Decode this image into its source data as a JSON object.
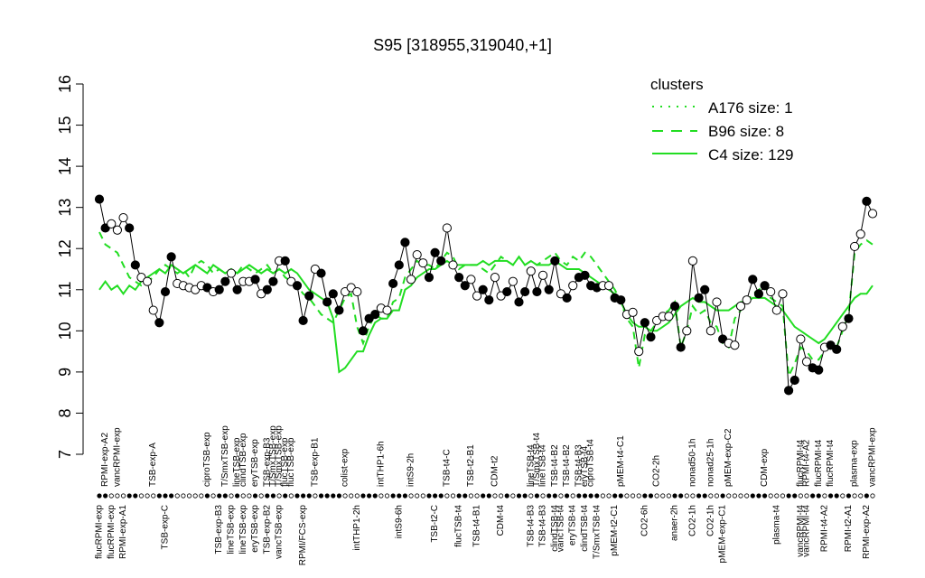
{
  "chart_data": {
    "type": "line",
    "title": "S95 [318955,319040,+1]",
    "xlabel": "",
    "ylabel": "",
    "ylim": [
      7,
      16
    ],
    "yticks": [
      7,
      8,
      9,
      10,
      11,
      12,
      13,
      14,
      15,
      16
    ],
    "grid": false,
    "legend": {
      "title": "clusters",
      "placement": "top-right",
      "color": "#22dd22",
      "items": [
        {
          "label": "A176 size: 1",
          "style": "dotted"
        },
        {
          "label": "B96 size: 8",
          "style": "dashed"
        },
        {
          "label": "C4 size: 129",
          "style": "solid"
        }
      ]
    },
    "top_labels": [
      {
        "i": 1,
        "t": "RPMI-exp-A2"
      },
      {
        "i": 3,
        "t": "vancRPMI-exp"
      },
      {
        "i": 9,
        "t": "TSB-exp-A"
      },
      {
        "i": 18,
        "t": "ciproTSB-exp"
      },
      {
        "i": 21,
        "t": "T/SmxTSB-exp"
      },
      {
        "i": 23,
        "t": "lineTSB-exp"
      },
      {
        "i": 24,
        "t": "clindTSB-exp"
      },
      {
        "i": 26,
        "t": "eryTSB-exp"
      },
      {
        "i": 28,
        "t": "TSB-exp-B3"
      },
      {
        "i": 29,
        "t": "T/SmxTSB-exp"
      },
      {
        "i": 30,
        "t": "T/SmxTSB-exp"
      },
      {
        "i": 31,
        "t": "flucTSB-exp"
      },
      {
        "i": 32,
        "t": "flucTSB-exp"
      },
      {
        "i": 36,
        "t": "TSB-exp-B1"
      },
      {
        "i": 41,
        "t": "colist-exp"
      },
      {
        "i": 47,
        "t": "intTHP1-6h"
      },
      {
        "i": 52,
        "t": "intS9-2h"
      },
      {
        "i": 58,
        "t": "TSB-t4-C"
      },
      {
        "i": 62,
        "t": "TSB-t2-B1"
      },
      {
        "i": 66,
        "t": "CDM-t2"
      },
      {
        "i": 72,
        "t": "lineTSB-t4"
      },
      {
        "i": 73,
        "t": "T/SmxTSB-t4"
      },
      {
        "i": 74,
        "t": "lineTSB-t4"
      },
      {
        "i": 76,
        "t": "TSB-t4-B2"
      },
      {
        "i": 78,
        "t": "TSB-t4-B2"
      },
      {
        "i": 80,
        "t": "TSB-t4-B3"
      },
      {
        "i": 81,
        "t": "eryTSB-t4"
      },
      {
        "i": 82,
        "t": "ciproTSB-t4"
      },
      {
        "i": 87,
        "t": "pMEM-t4-C1"
      },
      {
        "i": 93,
        "t": "CO2-2h"
      },
      {
        "i": 99,
        "t": "nonad50-1h"
      },
      {
        "i": 102,
        "t": "nonad25-1h"
      },
      {
        "i": 105,
        "t": "pMEM-exp-C2"
      },
      {
        "i": 111,
        "t": "CDM-exp"
      },
      {
        "i": 117,
        "t": "flucRPMI-t4"
      },
      {
        "i": 118,
        "t": "RPMI-t4-A2"
      },
      {
        "i": 120,
        "t": "flucRPMI-t4"
      },
      {
        "i": 122,
        "t": "flucRPMI-t4"
      },
      {
        "i": 126,
        "t": "plasma-exp"
      },
      {
        "i": 129,
        "t": "vancRPMI-exp"
      }
    ],
    "bottom_labels": [
      {
        "i": 0,
        "t": "flucRPMI-exp"
      },
      {
        "i": 2,
        "t": "flucRPMI-exp"
      },
      {
        "i": 4,
        "t": "RPMI-exp-A1"
      },
      {
        "i": 11,
        "t": "TSB-exp-C"
      },
      {
        "i": 20,
        "t": "TSB-exp-B3"
      },
      {
        "i": 22,
        "t": "lineTSB-exp"
      },
      {
        "i": 24,
        "t": "lineTSB-exp"
      },
      {
        "i": 26,
        "t": "eryTSB-exp"
      },
      {
        "i": 28,
        "t": "TSB-exp-B2"
      },
      {
        "i": 30,
        "t": "vancTSB-exp"
      },
      {
        "i": 34,
        "t": "RPMI/FCS-exp"
      },
      {
        "i": 43,
        "t": "intTHP1-2h"
      },
      {
        "i": 50,
        "t": "intS9-6h"
      },
      {
        "i": 56,
        "t": "TSB-t2-C"
      },
      {
        "i": 60,
        "t": "flucTSB-t4"
      },
      {
        "i": 63,
        "t": "TSB-t4-B1"
      },
      {
        "i": 67,
        "t": "CDM-t4"
      },
      {
        "i": 72,
        "t": "TSB-t4-B3"
      },
      {
        "i": 74,
        "t": "TSB-t4-B3"
      },
      {
        "i": 76,
        "t": "clindTSB-t4"
      },
      {
        "i": 77,
        "t": "vancTSB-t4"
      },
      {
        "i": 79,
        "t": "eryTSB-t4"
      },
      {
        "i": 81,
        "t": "clindTSB-t4"
      },
      {
        "i": 83,
        "t": "T/SmxTSB-t4"
      },
      {
        "i": 86,
        "t": "pMEM-t2-C1"
      },
      {
        "i": 91,
        "t": "CO2-6h"
      },
      {
        "i": 96,
        "t": "anaer-2h"
      },
      {
        "i": 99,
        "t": "CO2-1h"
      },
      {
        "i": 102,
        "t": "CO2-1h"
      },
      {
        "i": 104,
        "t": "pMEM-exp-C1"
      },
      {
        "i": 113,
        "t": "plasma-t4"
      },
      {
        "i": 117,
        "t": "vancRPMI-t4"
      },
      {
        "i": 118,
        "t": "vancRPMI-t4"
      },
      {
        "i": 121,
        "t": "RPMI-t4-A2"
      },
      {
        "i": 125,
        "t": "RPMI-t2-A1"
      },
      {
        "i": 128,
        "t": "RPMI-exp-A2"
      }
    ],
    "x_count": 130,
    "series": [
      {
        "style": "points",
        "values": [
          13.2,
          12.5,
          12.6,
          12.45,
          12.75,
          12.5,
          11.6,
          11.3,
          11.2,
          10.5,
          10.2,
          10.95,
          11.8,
          11.15,
          11.1,
          11.05,
          11.0,
          11.1,
          11.05,
          10.95,
          11.0,
          11.2,
          11.4,
          11.0,
          11.2,
          11.2,
          11.25,
          10.9,
          11.0,
          11.2,
          11.7,
          11.7,
          11.2,
          11.1,
          10.25,
          10.85,
          11.5,
          11.4,
          10.7,
          10.9,
          10.5,
          10.95,
          11.05,
          10.95,
          10.0,
          10.3,
          10.4,
          10.55,
          10.5,
          11.15,
          11.6,
          12.15,
          11.25,
          11.85,
          11.65,
          11.3,
          11.9,
          11.7,
          12.5,
          11.6,
          11.3,
          11.1,
          11.25,
          10.85,
          11.0,
          10.75,
          11.3,
          10.85,
          10.95,
          11.2,
          10.7,
          10.95,
          11.45,
          10.95,
          11.35,
          11.0,
          11.7,
          10.9,
          10.8,
          11.1,
          11.3,
          11.35,
          11.1,
          11.05,
          11.1,
          11.1,
          10.8,
          10.75,
          10.4,
          10.45,
          9.5,
          10.2,
          9.85,
          10.25,
          10.35,
          10.35,
          10.6,
          9.6,
          10.0,
          11.7,
          10.8,
          11.0,
          10.0,
          10.7,
          9.8,
          9.7,
          9.65,
          10.6,
          10.75,
          11.25,
          10.9,
          11.1,
          10.95,
          10.5,
          10.9,
          8.55,
          8.8,
          9.8,
          9.25,
          9.1,
          9.05,
          9.6,
          9.65,
          9.55,
          10.1,
          10.3,
          12.05,
          12.35,
          13.15,
          12.85
        ],
        "filled": [
          true,
          true,
          false,
          false,
          false,
          true,
          true,
          false,
          false,
          false,
          true,
          true,
          true,
          false,
          false,
          false,
          false,
          false,
          true,
          false,
          true,
          true,
          false,
          true,
          false,
          false,
          true,
          false,
          true,
          true,
          false,
          true,
          false,
          true,
          true,
          true,
          false,
          true,
          true,
          true,
          true,
          false,
          false,
          false,
          true,
          true,
          true,
          false,
          false,
          true,
          true,
          true,
          false,
          false,
          false,
          true,
          true,
          true,
          false,
          false,
          true,
          true,
          false,
          false,
          true,
          true,
          false,
          false,
          true,
          false,
          true,
          true,
          false,
          true,
          false,
          true,
          true,
          false,
          true,
          false,
          true,
          true,
          true,
          true,
          false,
          false,
          true,
          true,
          false,
          false,
          false,
          true,
          true,
          false,
          false,
          false,
          true,
          true,
          false,
          false,
          true,
          true,
          false,
          false,
          true,
          false,
          false,
          false,
          false,
          true,
          true,
          true,
          false,
          false,
          false,
          true,
          true,
          false,
          false,
          true,
          true,
          false,
          true,
          true,
          false,
          true,
          false,
          false,
          true,
          false
        ]
      },
      {
        "name": "B96",
        "style": "dashed",
        "values": [
          12.4,
          12.1,
          12.0,
          11.9,
          11.6,
          11.3,
          11.2,
          11.1,
          11.2,
          11.3,
          11.5,
          11.6,
          11.5,
          11.4,
          11.5,
          11.3,
          11.6,
          11.7,
          11.6,
          11.4,
          11.5,
          11.4,
          11.5,
          11.4,
          11.6,
          11.5,
          11.4,
          11.5,
          11.6,
          11.4,
          11.5,
          11.3,
          11.2,
          11.1,
          10.9,
          10.8,
          10.6,
          10.4,
          10.3,
          10.2,
          10.5,
          10.8,
          10.9,
          10.1,
          9.7,
          10.1,
          10.4,
          10.3,
          10.3,
          10.7,
          10.8,
          11.3,
          11.5,
          11.7,
          11.6,
          11.6,
          11.5,
          11.7,
          11.9,
          11.8,
          11.5,
          11.6,
          11.6,
          11.6,
          11.5,
          11.4,
          11.6,
          11.8,
          11.7,
          11.6,
          11.8,
          11.6,
          11.7,
          11.6,
          11.7,
          11.8,
          11.9,
          11.7,
          11.6,
          11.8,
          11.7,
          11.9,
          11.8,
          11.6,
          11.4,
          11.2,
          11.0,
          10.7,
          10.3,
          10.1,
          9.1,
          9.9,
          10.0,
          10.2,
          10.4,
          10.5,
          10.7,
          9.6,
          10.0,
          10.6,
          10.4,
          10.5,
          10.2,
          10.1,
          9.7,
          9.6,
          10.3,
          10.5,
          10.7,
          10.9,
          11.0,
          11.1,
          10.8,
          10.7,
          10.6,
          8.9,
          9.2,
          9.6,
          9.5,
          9.3,
          9.3,
          9.5,
          9.6,
          9.6,
          10.0,
          10.4,
          11.9,
          12.1,
          12.2,
          12.1
        ]
      },
      {
        "name": "C4",
        "style": "solid",
        "values": [
          11.0,
          11.2,
          11.0,
          11.1,
          10.9,
          11.1,
          11.0,
          11.2,
          11.3,
          11.4,
          11.5,
          11.4,
          11.6,
          11.5,
          11.4,
          11.5,
          11.6,
          11.5,
          11.4,
          11.6,
          11.5,
          11.4,
          11.5,
          11.4,
          11.5,
          11.6,
          11.5,
          11.4,
          11.5,
          11.4,
          11.5,
          11.4,
          11.5,
          11.4,
          11.2,
          11.0,
          10.9,
          10.8,
          10.7,
          10.3,
          9.0,
          9.1,
          9.3,
          9.5,
          9.5,
          9.9,
          10.2,
          10.3,
          10.3,
          10.5,
          10.5,
          11.0,
          11.1,
          11.3,
          11.4,
          11.5,
          11.5,
          11.6,
          11.7,
          11.6,
          11.6,
          11.6,
          11.6,
          11.6,
          11.7,
          11.6,
          11.7,
          11.7,
          11.7,
          11.6,
          11.8,
          11.6,
          11.7,
          11.6,
          11.6,
          11.6,
          11.7,
          11.6,
          11.5,
          11.5,
          11.5,
          11.4,
          11.3,
          11.2,
          11.1,
          11.0,
          10.9,
          10.7,
          10.4,
          10.2,
          10.1,
          10.1,
          10.0,
          10.0,
          10.1,
          10.2,
          10.4,
          10.6,
          10.7,
          10.8,
          10.7,
          10.7,
          10.6,
          10.5,
          10.5,
          10.5,
          10.6,
          10.7,
          10.7,
          10.8,
          10.8,
          10.8,
          10.7,
          10.6,
          10.5,
          10.3,
          10.1,
          10.0,
          9.9,
          9.8,
          9.7,
          9.8,
          10.0,
          10.2,
          10.4,
          10.6,
          10.8,
          10.9,
          10.9,
          11.1
        ]
      }
    ]
  }
}
